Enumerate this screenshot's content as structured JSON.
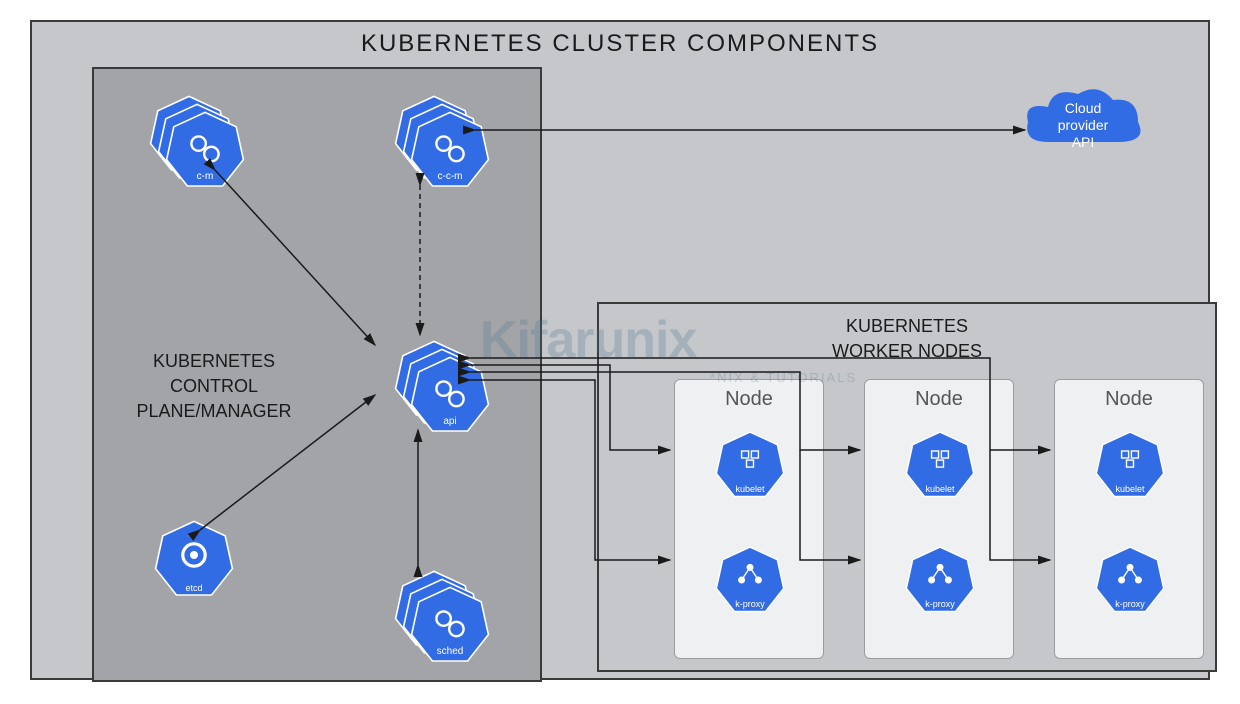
{
  "title": "KUBERNETES CLUSTER COMPONENTS",
  "control_plane": {
    "label_line1": "KUBERNETES",
    "label_line2": "CONTROL PLANE/MANAGER",
    "components": {
      "controller_manager": "c-m",
      "cloud_controller_manager": "c-c-m",
      "api_server": "api",
      "etcd": "etcd",
      "scheduler": "sched"
    }
  },
  "worker": {
    "label_line1": "KUBERNETES",
    "label_line2": "WORKER NODES",
    "node_label": "Node",
    "node_components": {
      "kubelet": "kubelet",
      "kube_proxy": "k-proxy"
    },
    "node_count": 3
  },
  "cloud": {
    "label_line1": "Cloud",
    "label_line2": "provider",
    "label_line3": "API"
  },
  "watermark": {
    "main": "Kifarunix",
    "sub": "*NIX & TUTORIALS"
  },
  "colors": {
    "k8s_blue": "#326ce5",
    "box_grey": "#c5c7ca",
    "box_grey_dark": "#a2a4a8",
    "border": "#3a3a3a"
  }
}
